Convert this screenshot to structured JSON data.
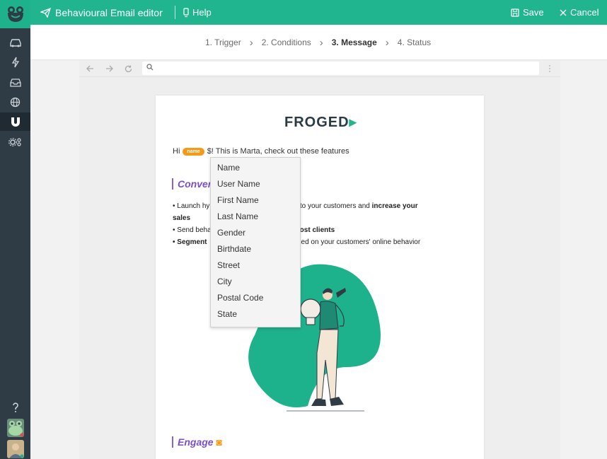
{
  "app": {
    "title": "Behavioural Email editor",
    "help_label": "Help",
    "save_label": "Save",
    "cancel_label": "Cancel"
  },
  "steps": [
    {
      "label": "1. Trigger",
      "active": false
    },
    {
      "label": "2. Conditions",
      "active": false
    },
    {
      "label": "3. Message",
      "active": true
    },
    {
      "label": "4. Status",
      "active": false
    }
  ],
  "sidebar": {
    "items": [
      {
        "icon": "car-icon"
      },
      {
        "icon": "lightning-icon"
      },
      {
        "icon": "inbox-icon"
      },
      {
        "icon": "globe-icon"
      },
      {
        "icon": "magnet-icon",
        "active": true
      },
      {
        "icon": "settings-icon"
      }
    ],
    "bottom": [
      {
        "icon": "help-icon"
      },
      {
        "icon": "frog-avatar-icon"
      },
      {
        "icon": "user-avatar-icon"
      }
    ]
  },
  "browser": {
    "url_value": "",
    "url_placeholder": ""
  },
  "email": {
    "logo_main": "FROGED",
    "greeting_prefix": "Hi",
    "name_tag": "name",
    "greeting_suffix": "$! This is Marta, check out these features",
    "section1_title": "Conver",
    "line1a": "• Launch hy",
    "line1b": "sages to your customers and ",
    "line1c": "increase your",
    "line1d": "sales",
    "line2a": "• Send beha",
    "line2b": "ost clients",
    "line3a": "• Segment",
    "line3b": "sed on your customers' online behavior",
    "section2_title": "Engage"
  },
  "dropdown": {
    "options": [
      "Name",
      "User Name",
      "First Name",
      "Last Name",
      "Gender",
      "Birthdate",
      "Street",
      "City",
      "Postal Code",
      "State"
    ]
  },
  "colors": {
    "brand_green": "#20b48f",
    "sidebar_dark": "#2f3b45",
    "accent_purple": "#7a4fc9",
    "tag_orange": "#f59a18"
  }
}
